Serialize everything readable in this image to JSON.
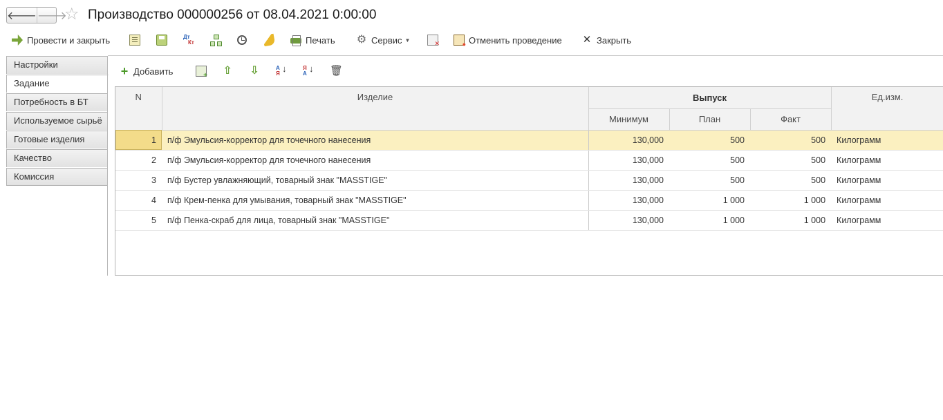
{
  "window": {
    "title": "Производство 000000256 от 08.04.2021 0:00:00",
    "back_icon": "arrow-left",
    "forward_icon": "arrow-right",
    "favorite_icon": "star"
  },
  "commandbar": {
    "post_and_close": "Провести и закрыть",
    "print": "Печать",
    "service": "Сервис",
    "cancel_posting": "Отменить проведение",
    "close": "Закрыть",
    "dt_label": "Дт",
    "kt_label": "Кт"
  },
  "tabs": [
    {
      "label": "Настройки",
      "active": false
    },
    {
      "label": "Задание",
      "active": true
    },
    {
      "label": "Потребность в БТ",
      "active": false
    },
    {
      "label": "Используемое сырьё",
      "active": false
    },
    {
      "label": "Готовые изделия",
      "active": false
    },
    {
      "label": "Качество",
      "active": false
    },
    {
      "label": "Комиссия",
      "active": false
    }
  ],
  "table_toolbar": {
    "add": "Добавить",
    "sort_top": "А",
    "sort_bottom": "Я",
    "sort_desc_top": "Я",
    "sort_desc_bottom": "А"
  },
  "table": {
    "headers": {
      "n": "N",
      "item": "Изделие",
      "output": "Выпуск",
      "minimum": "Минимум",
      "plan": "План",
      "fact": "Факт",
      "unit": "Ед.изм."
    },
    "rows": [
      {
        "n": "1",
        "item": "п/ф Эмульсия-корректор для точечного нанесения",
        "minimum": "130,000",
        "plan": "500",
        "fact": "500",
        "unit": "Килограмм"
      },
      {
        "n": "2",
        "item": "п/ф Эмульсия-корректор для точечного нанесения",
        "minimum": "130,000",
        "plan": "500",
        "fact": "500",
        "unit": "Килограмм"
      },
      {
        "n": "3",
        "item": "п/ф Бустер увлажняющий, товарный знак \"MASSTIGE\"",
        "minimum": "130,000",
        "plan": "500",
        "fact": "500",
        "unit": "Килограмм"
      },
      {
        "n": "4",
        "item": "п/ф Крем-пенка для умывания, товарный знак \"MASSTIGE\"",
        "minimum": "130,000",
        "plan": "1 000",
        "fact": "1 000",
        "unit": "Килограмм"
      },
      {
        "n": "5",
        "item": "п/ф Пенка-скраб для лица, товарный знак \"MASSTIGE\"",
        "minimum": "130,000",
        "plan": "1 000",
        "fact": "1 000",
        "unit": "Килограмм"
      }
    ]
  },
  "colors": {
    "selected_row": "#fbf0c0",
    "current_cell": "#f3dc8a",
    "accent_green": "#6aa33a"
  }
}
